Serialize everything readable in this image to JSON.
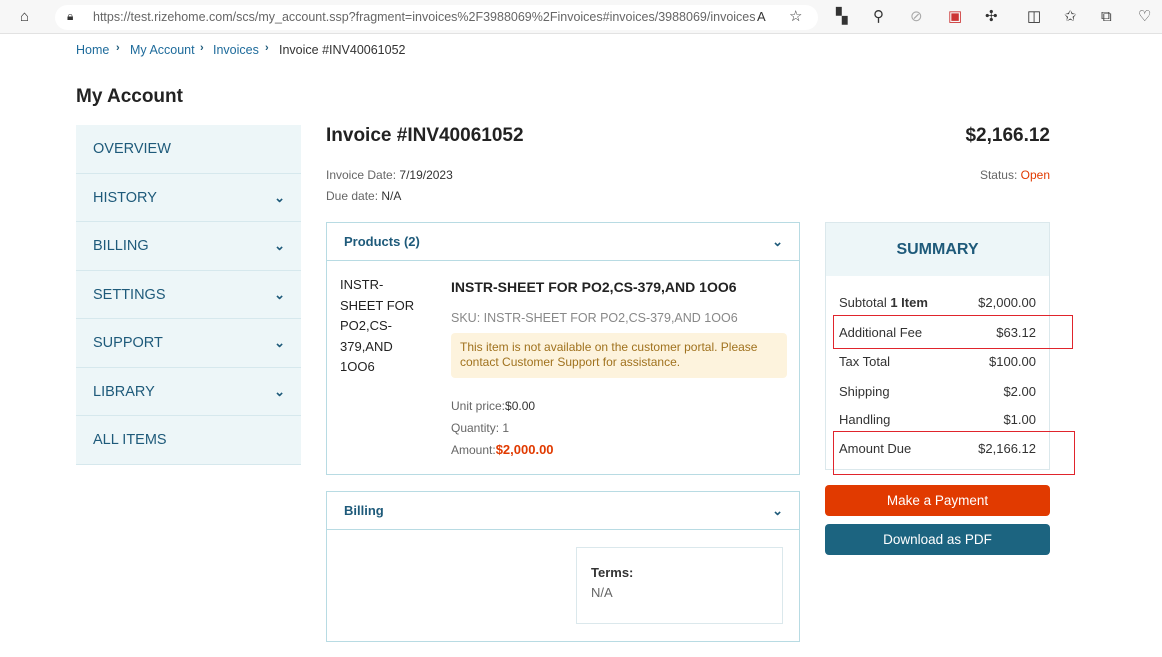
{
  "browser": {
    "url": "https://test.rizehome.com/scs/my_account.ssp?fragment=invoices%2F3988069%2Finvoices#invoices/3988069/invoices"
  },
  "breadcrumb": [
    "Home",
    "My Account",
    "Invoices",
    "Invoice #INV40061052"
  ],
  "page_title": "My Account",
  "sidebar": {
    "items": [
      {
        "label": "OVERVIEW",
        "expandable": false
      },
      {
        "label": "HISTORY",
        "expandable": true
      },
      {
        "label": "BILLING",
        "expandable": true
      },
      {
        "label": "SETTINGS",
        "expandable": true
      },
      {
        "label": "SUPPORT",
        "expandable": true
      },
      {
        "label": "LIBRARY",
        "expandable": true
      },
      {
        "label": "ALL ITEMS",
        "expandable": false
      }
    ]
  },
  "invoice": {
    "title": "Invoice #INV40061052",
    "total": "$2,166.12",
    "date_label": "Invoice Date:",
    "date": "7/19/2023",
    "due_label": "Due date:",
    "due": "N/A",
    "status_label": "Status:",
    "status": "Open"
  },
  "products": {
    "header": "Products (2)",
    "item": {
      "image_alt": "INSTR-SHEET FOR PO2,CS-379,AND 1OO6",
      "name": "INSTR-SHEET FOR PO2,CS-379,AND 1OO6",
      "sku": "SKU: INSTR-SHEET FOR PO2,CS-379,AND 1OO6",
      "notice": "This item is not available on the customer portal. Please contact Customer Support for assistance.",
      "unit_price_label": "Unit price:",
      "unit_price": "$0.00",
      "quantity_label": "Quantity:",
      "quantity": "1",
      "amount_label": "Amount:",
      "amount": "$2,000.00"
    }
  },
  "billing": {
    "header": "Billing",
    "terms_label": "Terms:",
    "terms": "N/A"
  },
  "summary": {
    "title": "SUMMARY",
    "subtotal_label": "Subtotal",
    "subtotal_items": "1 Item",
    "subtotal": "$2,000.00",
    "fee_label": "Additional Fee",
    "fee": "$63.12",
    "tax_label": "Tax Total",
    "tax": "$100.00",
    "shipping_label": "Shipping",
    "shipping": "$2.00",
    "handling_label": "Handling",
    "handling": "$1.00",
    "due_label": "Amount Due",
    "due": "$2,166.12"
  },
  "actions": {
    "pay": "Make a Payment",
    "pdf": "Download as PDF"
  },
  "colors": {
    "accent": "#1e5a7a",
    "pay_button": "#e13a00",
    "pdf_button": "#1c6480",
    "status_open": "#e13a00",
    "highlight": "#e0242c"
  }
}
